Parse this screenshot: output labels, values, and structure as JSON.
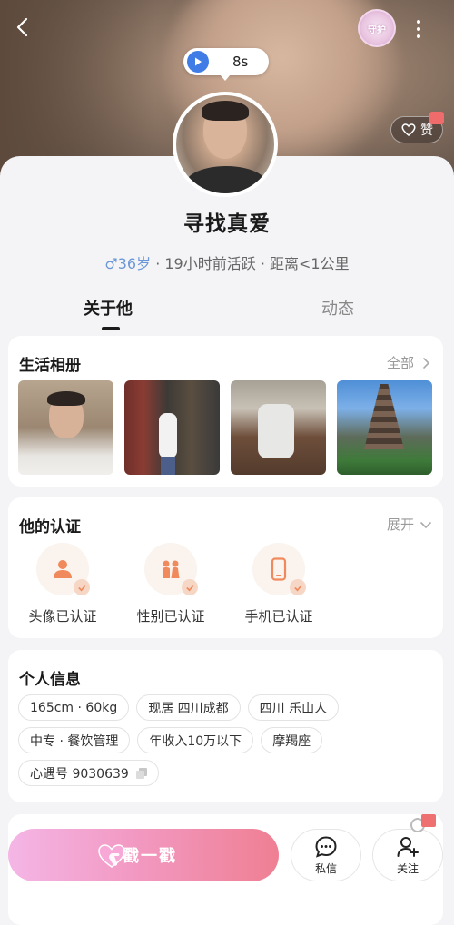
{
  "header": {
    "voice_duration": "8s",
    "guard_badge_text": "守护",
    "like_label": "赞"
  },
  "profile": {
    "nickname": "寻找真爱",
    "gender_symbol": "♂",
    "age": "36岁",
    "active": " · 19小时前活跃 · ",
    "distance": "距离<1公里"
  },
  "tabs": [
    {
      "label": "关于他",
      "active": true
    },
    {
      "label": "动态",
      "active": false
    }
  ],
  "album": {
    "title": "生活相册",
    "action": "全部"
  },
  "verification": {
    "title": "他的认证",
    "action": "展开",
    "items": [
      {
        "label": "头像已认证",
        "icon": "person-icon"
      },
      {
        "label": "性别已认证",
        "icon": "gender-people-icon"
      },
      {
        "label": "手机已认证",
        "icon": "phone-icon"
      }
    ]
  },
  "personal_info": {
    "title": "个人信息",
    "rows": [
      [
        "165cm · 60kg",
        "现居 四川成都",
        "四川 乐山人"
      ],
      [
        "中专 · 餐饮管理",
        "年收入10万以下",
        "摩羯座"
      ],
      [
        "心遇号 9030639"
      ]
    ]
  },
  "bottom_bar": {
    "poke_label": "戳一戳",
    "message_label": "私信",
    "follow_label": "关注"
  },
  "colors": {
    "accent_blue": "#3f7ce6",
    "poke_gradient_start": "#f4b6e6",
    "poke_gradient_end": "#ef7f93",
    "verify_orange": "#f08a5d"
  }
}
